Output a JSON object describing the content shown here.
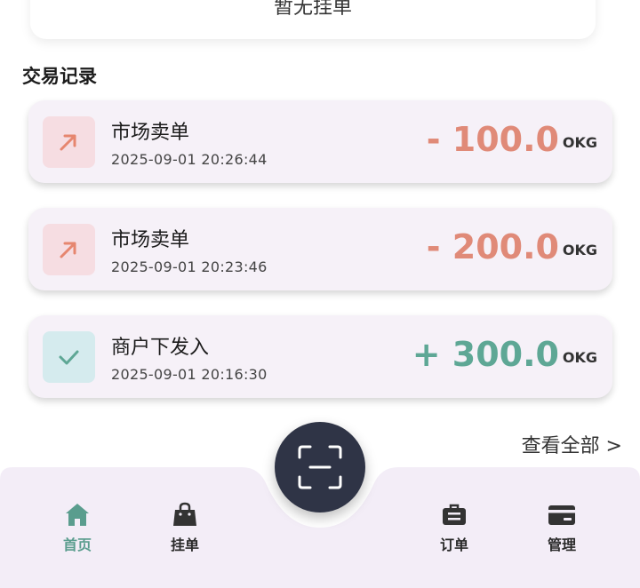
{
  "top_card": {
    "empty_text": "暂无挂单"
  },
  "section_title": "交易记录",
  "transactions": [
    {
      "title": "市场卖单",
      "time": "2025-09-01 20:26:44",
      "amount": "- 100.0",
      "unit": "OKG",
      "icon": "arrow-up-right-icon",
      "direction": "out"
    },
    {
      "title": "市场卖单",
      "time": "2025-09-01 20:23:46",
      "amount": "- 200.0",
      "unit": "OKG",
      "icon": "arrow-up-right-icon",
      "direction": "out"
    },
    {
      "title": "商户下发入",
      "time": "2025-09-01 20:16:30",
      "amount": "+ 300.0",
      "unit": "OKG",
      "icon": "check-icon",
      "direction": "in"
    }
  ],
  "view_all": "查看全部 >",
  "nav": {
    "items": [
      {
        "label": "首页",
        "icon": "home-icon",
        "active": true
      },
      {
        "label": "挂单",
        "icon": "bag-icon",
        "active": false
      },
      {
        "label": "订单",
        "icon": "briefcase-icon",
        "active": false
      },
      {
        "label": "管理",
        "icon": "card-icon",
        "active": false
      }
    ],
    "center": {
      "icon": "scan-icon"
    }
  },
  "colors": {
    "accent": "#5a9d8e",
    "negative": "#e08a78",
    "positive": "#5ea795",
    "nav_background": "#f3edf7",
    "scan_button": "#2f3446"
  }
}
